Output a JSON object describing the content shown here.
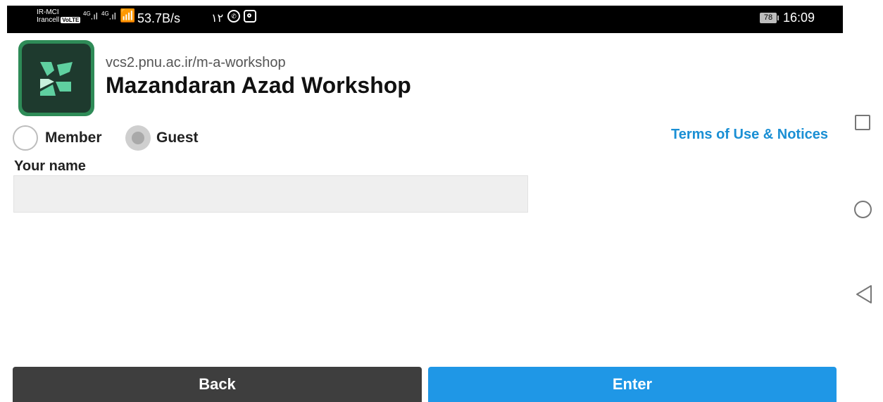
{
  "status_bar": {
    "carrier_1": "IR-MCI",
    "carrier_2": "Irancell",
    "volte": "VoLTE",
    "network_1": "4G",
    "network_2": "4G",
    "net_speed": "53.7B/s",
    "notification_count": "۱۲",
    "battery_level": "78",
    "time": "16:09"
  },
  "header": {
    "url": "vcs2.pnu.ac.ir/m-a-workshop",
    "title": "Mazandaran Azad Workshop"
  },
  "login_type": {
    "options": [
      {
        "label": "Member",
        "selected": false
      },
      {
        "label": "Guest",
        "selected": true
      }
    ]
  },
  "terms_link": "Terms of Use & Notices",
  "name_field": {
    "label": "Your name",
    "value": ""
  },
  "buttons": {
    "back": "Back",
    "enter": "Enter"
  },
  "colors": {
    "accent": "#1f97e6",
    "link": "#1a8fd4",
    "back_button": "#3e3e3e",
    "logo_bg": "#1e3a2e"
  },
  "icons": [
    "wifi-icon",
    "whatsapp-icon",
    "instagram-icon",
    "battery-icon",
    "recents-icon",
    "home-icon",
    "back-nav-icon"
  ]
}
